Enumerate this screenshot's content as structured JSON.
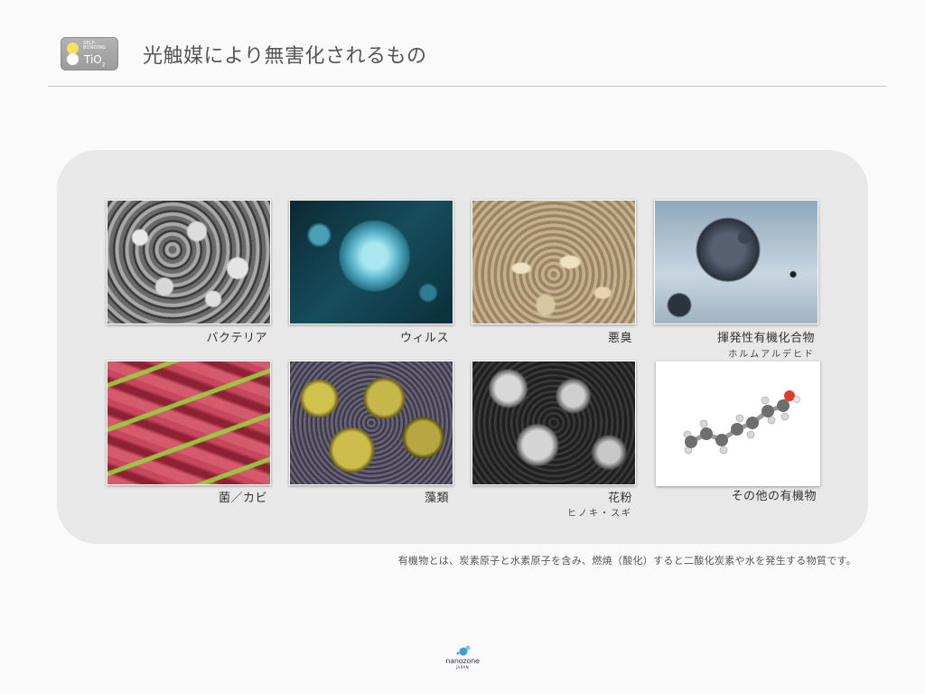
{
  "header": {
    "logo": {
      "small_text": "SELF-\nBONDING",
      "main_text": "TiO",
      "subscript": "2"
    },
    "title": "光触媒により無害化されるもの"
  },
  "grid": [
    {
      "name": "bacteria",
      "caption": "バクテリア",
      "subcaption": ""
    },
    {
      "name": "virus",
      "caption": "ウィルス",
      "subcaption": ""
    },
    {
      "name": "odor",
      "caption": "悪臭",
      "subcaption": ""
    },
    {
      "name": "voc",
      "caption": "揮発性有機化合物",
      "subcaption": "ホルムアルデヒド"
    },
    {
      "name": "fungi",
      "caption": "菌／カビ",
      "subcaption": ""
    },
    {
      "name": "algae",
      "caption": "藻類",
      "subcaption": ""
    },
    {
      "name": "pollen",
      "caption": "花粉",
      "subcaption": "ヒノキ・スギ"
    },
    {
      "name": "organic",
      "caption": "その他の有機物",
      "subcaption": ""
    }
  ],
  "footnote": "有機物とは、炭素原子と水素原子を含み、燃焼（酸化）すると二酸化炭素や水を発生する物質です。",
  "brand": {
    "wordmark": "nanozone",
    "sub": "JAPAN"
  },
  "colors": {
    "panel": "#e8e8e8",
    "background": "#fafafa",
    "logo_yellow": "#f3e25a"
  }
}
